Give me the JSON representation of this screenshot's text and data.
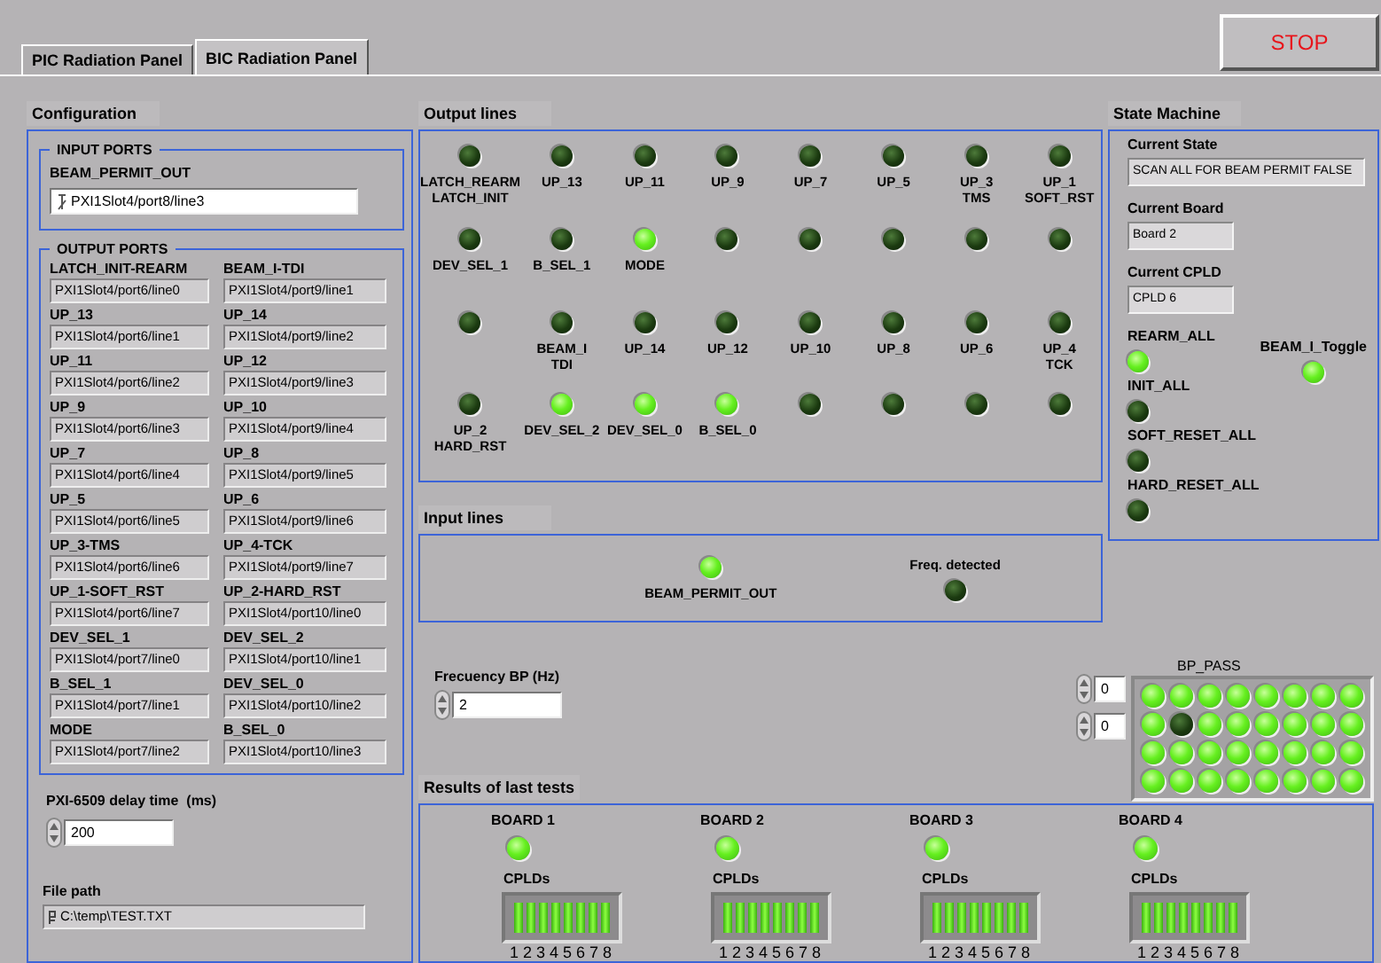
{
  "tabs": [
    {
      "label": "PIC Radiation Panel",
      "selected": false
    },
    {
      "label": "BIC Radiation Panel",
      "selected": true
    }
  ],
  "stop_button": {
    "label": "STOP"
  },
  "configuration": {
    "title": "Configuration",
    "input_ports": {
      "title": "INPUT PORTS",
      "ports": [
        {
          "label": "BEAM_PERMIT_OUT",
          "value": "PXI1Slot4/port8/line3"
        }
      ]
    },
    "output_ports": {
      "title": "OUTPUT PORTS",
      "ports": [
        {
          "label": "LATCH_INIT-REARM",
          "value": "PXI1Slot4/port6/line0"
        },
        {
          "label": "BEAM_I-TDI",
          "value": "PXI1Slot4/port9/line1"
        },
        {
          "label": "UP_13",
          "value": "PXI1Slot4/port6/line1"
        },
        {
          "label": "UP_14",
          "value": "PXI1Slot4/port9/line2"
        },
        {
          "label": "UP_11",
          "value": "PXI1Slot4/port6/line2"
        },
        {
          "label": "UP_12",
          "value": "PXI1Slot4/port9/line3"
        },
        {
          "label": "UP_9",
          "value": "PXI1Slot4/port6/line3"
        },
        {
          "label": "UP_10",
          "value": "PXI1Slot4/port9/line4"
        },
        {
          "label": "UP_7",
          "value": "PXI1Slot4/port6/line4"
        },
        {
          "label": "UP_8",
          "value": "PXI1Slot4/port9/line5"
        },
        {
          "label": "UP_5",
          "value": "PXI1Slot4/port6/line5"
        },
        {
          "label": "UP_6",
          "value": "PXI1Slot4/port9/line6"
        },
        {
          "label": "UP_3-TMS",
          "value": "PXI1Slot4/port6/line6"
        },
        {
          "label": "UP_4-TCK",
          "value": "PXI1Slot4/port9/line7"
        },
        {
          "label": "UP_1-SOFT_RST",
          "value": "PXI1Slot4/port6/line7"
        },
        {
          "label": "UP_2-HARD_RST",
          "value": "PXI1Slot4/port10/line0"
        },
        {
          "label": "DEV_SEL_1",
          "value": "PXI1Slot4/port7/line0"
        },
        {
          "label": "DEV_SEL_2",
          "value": "PXI1Slot4/port10/line1"
        },
        {
          "label": "B_SEL_1",
          "value": "PXI1Slot4/port7/line1"
        },
        {
          "label": "DEV_SEL_0",
          "value": "PXI1Slot4/port10/line2"
        },
        {
          "label": "MODE",
          "value": "PXI1Slot4/port7/line2"
        },
        {
          "label": "B_SEL_0",
          "value": "PXI1Slot4/port10/line3"
        }
      ]
    },
    "delay": {
      "label": "PXI-6509 delay time  (ms)",
      "value": "200"
    },
    "file_path": {
      "label": "File path",
      "value": "C:\\temp\\TEST.TXT"
    }
  },
  "output_lines": {
    "title": "Output lines",
    "leds": [
      {
        "label": "LATCH_REARM\nLATCH_INIT",
        "on": false
      },
      {
        "label": "UP_13",
        "on": false
      },
      {
        "label": "UP_11",
        "on": false
      },
      {
        "label": "UP_9",
        "on": false
      },
      {
        "label": "UP_7",
        "on": false
      },
      {
        "label": "UP_5",
        "on": false
      },
      {
        "label": "UP_3\nTMS",
        "on": false
      },
      {
        "label": "UP_1\nSOFT_RST",
        "on": false
      },
      {
        "label": "DEV_SEL_1",
        "on": false
      },
      {
        "label": "B_SEL_1",
        "on": false
      },
      {
        "label": "MODE",
        "on": true
      },
      {
        "on": false
      },
      {
        "on": false
      },
      {
        "on": false
      },
      {
        "on": false
      },
      {
        "on": false
      },
      {
        "on": false
      },
      {
        "label": "BEAM_I\nTDI",
        "on": false
      },
      {
        "label": "UP_14",
        "on": false
      },
      {
        "label": "UP_12",
        "on": false
      },
      {
        "label": "UP_10",
        "on": false
      },
      {
        "label": "UP_8",
        "on": false
      },
      {
        "label": "UP_6",
        "on": false
      },
      {
        "label": "UP_4\nTCK",
        "on": false
      },
      {
        "label": "UP_2\nHARD_RST",
        "on": false
      },
      {
        "label": "DEV_SEL_2",
        "on": true
      },
      {
        "label": "DEV_SEL_0",
        "on": true
      },
      {
        "label": "B_SEL_0",
        "on": true
      },
      {
        "on": false
      },
      {
        "on": false
      },
      {
        "on": false
      },
      {
        "on": false
      }
    ]
  },
  "input_lines": {
    "title": "Input lines",
    "leds": [
      {
        "label": "BEAM_PERMIT_OUT",
        "on": true
      },
      {
        "label": "Freq. detected",
        "on": false
      }
    ]
  },
  "state_machine": {
    "title": "State Machine",
    "fields": [
      {
        "label": "Current State",
        "value": "SCAN ALL FOR BEAM PERMIT FALSE"
      },
      {
        "label": "Current Board",
        "value": "Board 2"
      },
      {
        "label": "Current CPLD",
        "value": "CPLD 6"
      }
    ],
    "leds": [
      {
        "label": "REARM_ALL",
        "on": true
      },
      {
        "label": "INIT_ALL",
        "on": false
      },
      {
        "label": "SOFT_RESET_ALL",
        "on": false
      },
      {
        "label": "HARD_RESET_ALL",
        "on": false
      }
    ],
    "toggle": {
      "label": "BEAM_I_Toggle",
      "on": true
    }
  },
  "frequency": {
    "label": "Frecuency BP (Hz)",
    "value": "2"
  },
  "bp_pass": {
    "label": "BP_PASS",
    "indices": [
      "0",
      "0"
    ],
    "rows": [
      [
        true,
        true,
        true,
        true,
        true,
        true,
        true,
        true
      ],
      [
        true,
        false,
        true,
        true,
        true,
        true,
        true,
        true
      ],
      [
        true,
        true,
        true,
        true,
        true,
        true,
        true,
        true
      ],
      [
        true,
        true,
        true,
        true,
        true,
        true,
        true,
        true
      ]
    ]
  },
  "results": {
    "title": "Results of last tests",
    "boards": [
      {
        "label": "BOARD 1",
        "on": true,
        "cplds_label": "CPLDs",
        "cplds": [
          {
            "label": "1",
            "on": true
          },
          {
            "label": "2",
            "on": true
          },
          {
            "label": "3",
            "on": true
          },
          {
            "label": "4",
            "on": true
          },
          {
            "label": "5",
            "on": true
          },
          {
            "label": "6",
            "on": true
          },
          {
            "label": "7",
            "on": true
          },
          {
            "label": "8",
            "on": true
          }
        ]
      },
      {
        "label": "BOARD 2",
        "on": true,
        "cplds_label": "CPLDs",
        "cplds": [
          {
            "label": "1",
            "on": true
          },
          {
            "label": "2",
            "on": true
          },
          {
            "label": "3",
            "on": true
          },
          {
            "label": "4",
            "on": true
          },
          {
            "label": "5",
            "on": true
          },
          {
            "label": "6",
            "on": true
          },
          {
            "label": "7",
            "on": true
          },
          {
            "label": "8",
            "on": true
          }
        ]
      },
      {
        "label": "BOARD 3",
        "on": true,
        "cplds_label": "CPLDs",
        "cplds": [
          {
            "label": "1",
            "on": true
          },
          {
            "label": "2",
            "on": true
          },
          {
            "label": "3",
            "on": true
          },
          {
            "label": "4",
            "on": true
          },
          {
            "label": "5",
            "on": true
          },
          {
            "label": "6",
            "on": true
          },
          {
            "label": "7",
            "on": true
          },
          {
            "label": "8",
            "on": true
          }
        ]
      },
      {
        "label": "BOARD 4",
        "on": true,
        "cplds_label": "CPLDs",
        "cplds": [
          {
            "label": "1",
            "on": true
          },
          {
            "label": "2",
            "on": true
          },
          {
            "label": "3",
            "on": true
          },
          {
            "label": "4",
            "on": true
          },
          {
            "label": "5",
            "on": true
          },
          {
            "label": "6",
            "on": true
          },
          {
            "label": "7",
            "on": true
          },
          {
            "label": "8",
            "on": true
          }
        ]
      }
    ]
  }
}
